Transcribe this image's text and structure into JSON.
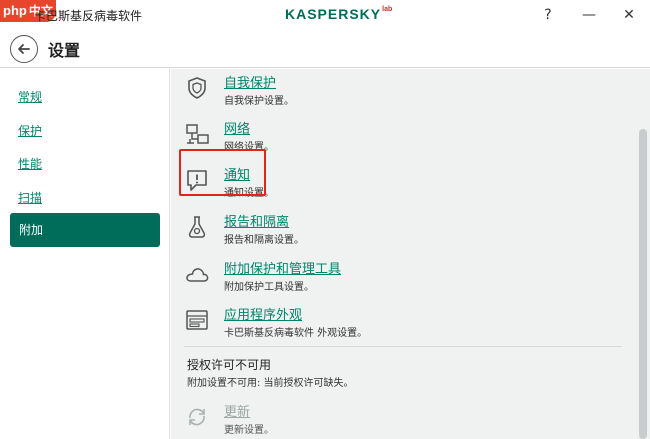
{
  "watermark": {
    "text": "php",
    "sub": "中文网"
  },
  "window": {
    "title": "卡巴斯基反病毒软件",
    "logo": "KASPERSKY",
    "logo_suffix": "lab",
    "help": "?",
    "minimize": "—",
    "close": "✕"
  },
  "header": {
    "title": "设置"
  },
  "sidebar": {
    "items": [
      {
        "label": "常规"
      },
      {
        "label": "保护"
      },
      {
        "label": "性能"
      },
      {
        "label": "扫描"
      },
      {
        "label": "附加"
      }
    ],
    "active": "附加"
  },
  "main": {
    "entries": [
      {
        "title": "自我保护",
        "desc": "自我保护设置。",
        "icon": "shield-icon"
      },
      {
        "title": "网络",
        "desc": "网络设置。",
        "icon": "network-icon"
      },
      {
        "title": "通知",
        "desc": "通知设置。",
        "icon": "notification-icon"
      },
      {
        "title": "报告和隔离",
        "desc": "报告和隔离设置。",
        "icon": "flask-icon"
      },
      {
        "title": "附加保护和管理工具",
        "desc": "附加保护工具设置。",
        "icon": "cloud-icon"
      },
      {
        "title": "应用程序外观",
        "desc": "卡巴斯基反病毒软件 外观设置。",
        "icon": "appearance-icon"
      }
    ],
    "license_section": {
      "title": "授权许可不可用",
      "desc": "附加设置不可用: 当前授权许可缺失。"
    },
    "update_entry": {
      "title": "更新",
      "desc": "更新设置。",
      "icon": "update-icon",
      "disabled": true
    }
  },
  "colors": {
    "accent": "#006d5b",
    "link": "#00856a",
    "highlight": "#e0231b"
  }
}
